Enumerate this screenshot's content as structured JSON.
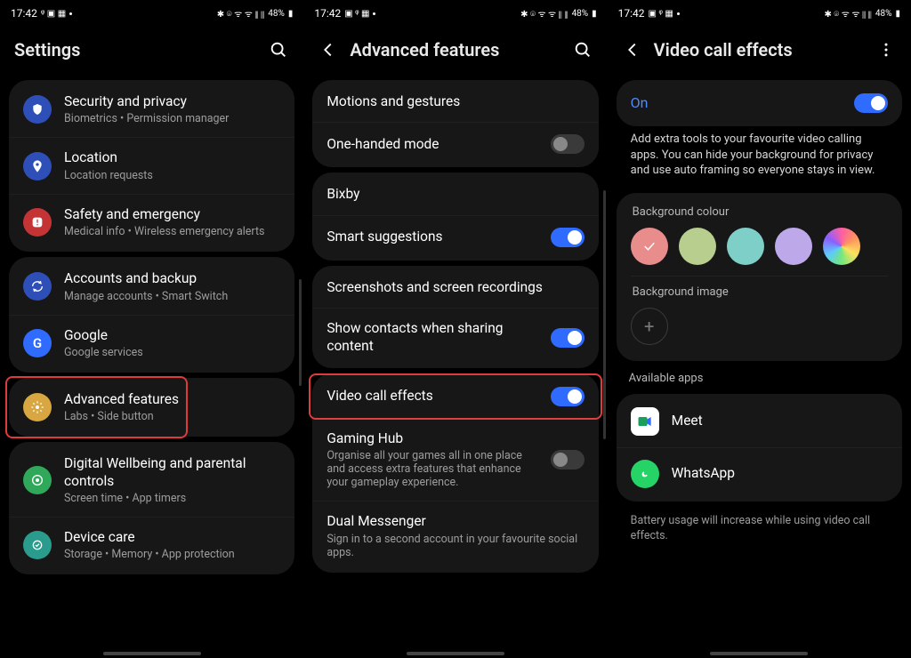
{
  "status": {
    "time": "17:42",
    "battery": "48%"
  },
  "screen1": {
    "title": "Settings",
    "group1": [
      {
        "icon": "#2f4fb8",
        "glyph": "shield",
        "title": "Security and privacy",
        "sub": "Biometrics  •  Permission manager"
      },
      {
        "icon": "#2f4fb8",
        "glyph": "pin",
        "title": "Location",
        "sub": "Location requests"
      },
      {
        "icon": "#c43434",
        "glyph": "alert",
        "title": "Safety and emergency",
        "sub": "Medical info  •  Wireless emergency alerts"
      }
    ],
    "group2": [
      {
        "icon": "#2f4fb8",
        "glyph": "sync",
        "title": "Accounts and backup",
        "sub": "Manage accounts  •  Smart Switch"
      },
      {
        "icon": "#2f4fb8",
        "glyph": "g",
        "title": "Google",
        "sub": "Google services"
      }
    ],
    "group3": [
      {
        "icon": "#d8a742",
        "glyph": "gear",
        "title": "Advanced features",
        "sub": "Labs  •  Side button",
        "highlight": true
      }
    ],
    "group4": [
      {
        "icon": "#2fa85a",
        "glyph": "wellb",
        "title": "Digital Wellbeing and parental controls",
        "sub": "Screen time  •  App timers"
      },
      {
        "icon": "#2a9c8e",
        "glyph": "device",
        "title": "Device care",
        "sub": "Storage  •  Memory  •  App protection"
      }
    ]
  },
  "screen2": {
    "title": "Advanced features",
    "g1": [
      {
        "title": "Motions and gestures"
      },
      {
        "title": "One-handed mode",
        "toggle": "off"
      }
    ],
    "g2": [
      {
        "title": "Bixby"
      },
      {
        "title": "Smart suggestions",
        "toggle": "on"
      }
    ],
    "g3": [
      {
        "title": "Screenshots and screen recordings"
      },
      {
        "title": "Show contacts when sharing content",
        "toggle": "on"
      }
    ],
    "g4": [
      {
        "title": "Video call effects",
        "toggle": "on",
        "highlight": true
      },
      {
        "title": "Gaming Hub",
        "sub": "Organise all your games all in one place and access extra features that enhance your gameplay experience.",
        "toggle": "off"
      },
      {
        "title": "Dual Messenger",
        "sub": "Sign in to a second account in your favourite social apps."
      }
    ]
  },
  "screen3": {
    "title": "Video call effects",
    "on_label": "On",
    "desc": "Add extra tools to your favourite video calling apps. You can hide your background for privacy and use auto framing so everyone stays in view.",
    "bg_colour_label": "Background colour",
    "swatches": [
      "#e88c8c",
      "#b8ce8f",
      "#7dcfc7",
      "#bda9ea",
      "rainbow"
    ],
    "bg_image_label": "Background image",
    "available_label": "Available apps",
    "apps": [
      {
        "name": "Meet"
      },
      {
        "name": "WhatsApp"
      }
    ],
    "footer": "Battery usage will increase while using video call effects."
  }
}
